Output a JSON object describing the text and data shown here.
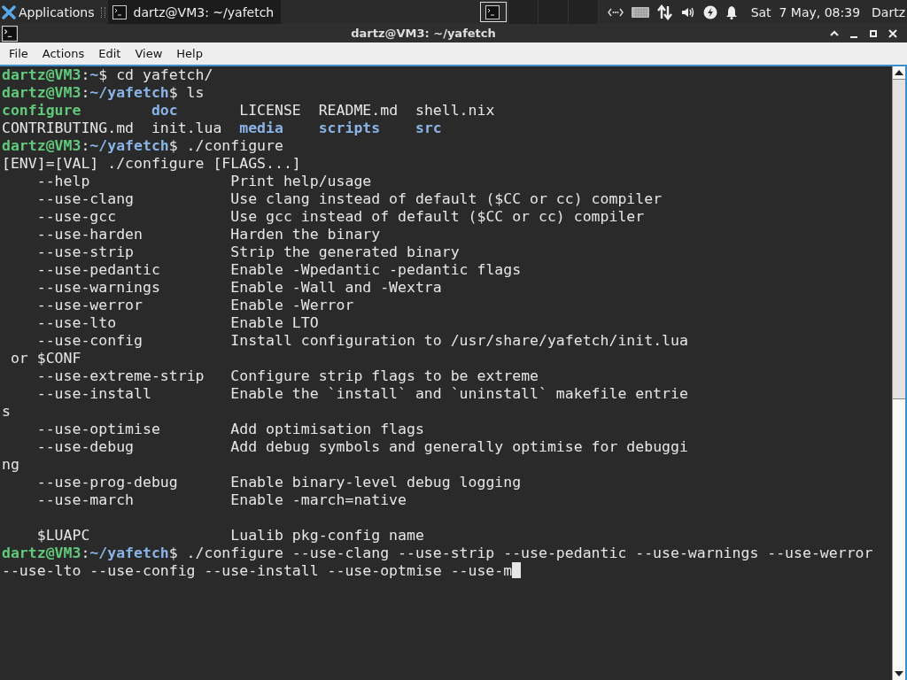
{
  "panel": {
    "menu_label": "Applications",
    "tasks": [
      {
        "title": "dartz@VM3: ~/yafetch",
        "selected": true
      }
    ],
    "workspaces": [
      {
        "selected": true,
        "has_window": true
      },
      {
        "selected": false,
        "has_window": false
      },
      {
        "selected": false,
        "has_window": false
      },
      {
        "selected": false,
        "has_window": false
      }
    ],
    "clock": "Sat  7 May, 08:39",
    "user": "Dartz"
  },
  "window": {
    "title": "dartz@VM3: ~/yafetch"
  },
  "menu": [
    "File",
    "Actions",
    "Edit",
    "View",
    "Help"
  ],
  "terminal": {
    "lines": [
      {
        "segments": [
          {
            "kind": "user",
            "text": "dartz@VM3"
          },
          {
            "kind": "plain",
            "text": ":"
          },
          {
            "kind": "path",
            "text": "~"
          },
          {
            "kind": "plain",
            "text": "$ cd yafetch/"
          }
        ]
      },
      {
        "segments": [
          {
            "kind": "user",
            "text": "dartz@VM3"
          },
          {
            "kind": "plain",
            "text": ":"
          },
          {
            "kind": "path",
            "text": "~/yafetch"
          },
          {
            "kind": "plain",
            "text": "$ ls"
          }
        ]
      },
      {
        "segments": [
          {
            "kind": "exec",
            "text": "configure"
          },
          {
            "kind": "dir",
            "text": "        doc"
          },
          {
            "kind": "plain",
            "text": "       LICENSE  README.md  shell.nix"
          }
        ]
      },
      {
        "segments": [
          {
            "kind": "plain",
            "text": "CONTRIBUTING.md  init.lua"
          },
          {
            "kind": "dir",
            "text": "  media"
          },
          {
            "kind": "dir",
            "text": "    scripts"
          },
          {
            "kind": "dir",
            "text": "    src"
          }
        ]
      },
      {
        "segments": [
          {
            "kind": "user",
            "text": "dartz@VM3"
          },
          {
            "kind": "plain",
            "text": ":"
          },
          {
            "kind": "path",
            "text": "~/yafetch"
          },
          {
            "kind": "plain",
            "text": "$ ./configure"
          }
        ]
      },
      {
        "segments": [
          {
            "kind": "plain",
            "text": "[ENV]=[VAL] ./configure [FLAGS...]"
          }
        ]
      },
      {
        "segments": [
          {
            "kind": "plain",
            "text": "    --help                Print help/usage"
          }
        ]
      },
      {
        "segments": [
          {
            "kind": "plain",
            "text": "    --use-clang           Use clang instead of default ($CC or cc) compiler"
          }
        ]
      },
      {
        "segments": [
          {
            "kind": "plain",
            "text": "    --use-gcc             Use gcc instead of default ($CC or cc) compiler"
          }
        ]
      },
      {
        "segments": [
          {
            "kind": "plain",
            "text": "    --use-harden          Harden the binary"
          }
        ]
      },
      {
        "segments": [
          {
            "kind": "plain",
            "text": "    --use-strip           Strip the generated binary"
          }
        ]
      },
      {
        "segments": [
          {
            "kind": "plain",
            "text": "    --use-pedantic        Enable -Wpedantic -pedantic flags"
          }
        ]
      },
      {
        "segments": [
          {
            "kind": "plain",
            "text": "    --use-warnings        Enable -Wall and -Wextra"
          }
        ]
      },
      {
        "segments": [
          {
            "kind": "plain",
            "text": "    --use-werror          Enable -Werror"
          }
        ]
      },
      {
        "segments": [
          {
            "kind": "plain",
            "text": "    --use-lto             Enable LTO"
          }
        ]
      },
      {
        "segments": [
          {
            "kind": "plain",
            "text": "    --use-config          Install configuration to /usr/share/yafetch/init.lua"
          }
        ]
      },
      {
        "segments": [
          {
            "kind": "plain",
            "text": " or $CONF"
          }
        ]
      },
      {
        "segments": [
          {
            "kind": "plain",
            "text": "    --use-extreme-strip   Configure strip flags to be extreme"
          }
        ]
      },
      {
        "segments": [
          {
            "kind": "plain",
            "text": "    --use-install         Enable the `install` and `uninstall` makefile entrie"
          }
        ]
      },
      {
        "segments": [
          {
            "kind": "plain",
            "text": "s"
          }
        ]
      },
      {
        "segments": [
          {
            "kind": "plain",
            "text": "    --use-optimise        Add optimisation flags"
          }
        ]
      },
      {
        "segments": [
          {
            "kind": "plain",
            "text": "    --use-debug           Add debug symbols and generally optimise for debuggi"
          }
        ]
      },
      {
        "segments": [
          {
            "kind": "plain",
            "text": "ng"
          }
        ]
      },
      {
        "segments": [
          {
            "kind": "plain",
            "text": "    --use-prog-debug      Enable binary-level debug logging"
          }
        ]
      },
      {
        "segments": [
          {
            "kind": "plain",
            "text": "    --use-march           Enable -march=native"
          }
        ]
      },
      {
        "gap_before": true,
        "segments": [
          {
            "kind": "plain",
            "text": "    $LUAPC                Lualib pkg-config name"
          }
        ]
      },
      {
        "segments": [
          {
            "kind": "user",
            "text": "dartz@VM3"
          },
          {
            "kind": "plain",
            "text": ":"
          },
          {
            "kind": "path",
            "text": "~/yafetch"
          },
          {
            "kind": "plain",
            "text": "$ ./configure --use-clang --use-strip --use-pedantic --use-warnings --use-werror"
          }
        ]
      },
      {
        "segments": [
          {
            "kind": "plain",
            "text": "--use-lto --use-config --use-install --use-optmise --use-m"
          }
        ],
        "cursor": true
      }
    ]
  }
}
